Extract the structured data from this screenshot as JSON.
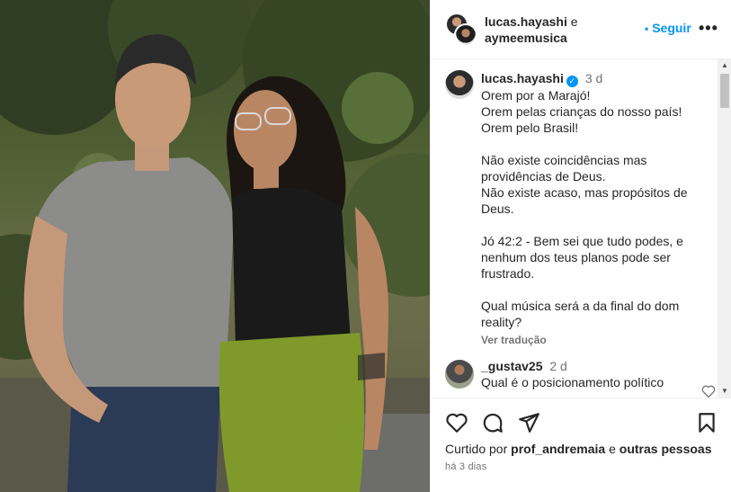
{
  "post": {
    "author_1": "lucas.hayashi",
    "connector": "e",
    "author_2": "aymeemusica",
    "follow_label": "Seguir",
    "more_label": "•••"
  },
  "caption": {
    "username": "lucas.hayashi",
    "verified_mark": "✓",
    "time": "3 d",
    "text": "Orem por a Marajó!\nOrem pelas crianças do nosso país!\nOrem pelo Brasil!\n\nNão existe coincidências mas providências de Deus.\nNão existe acaso, mas propósitos de Deus.\n\nJó 42:2 - Bem sei que tudo podes, e nenhum dos teus planos pode ser frustrado.\n\nQual música será a da final do dom reality?",
    "see_translation": "Ver tradução"
  },
  "comment": {
    "username": "_gustav25",
    "time": "2 d",
    "text": "Qual é o posicionamento político"
  },
  "footer": {
    "liked_prefix": "Curtido por",
    "liked_user": "prof_andremaia",
    "liked_connector": "e",
    "liked_others": "outras pessoas",
    "time_ago": "há 3 dias"
  },
  "icons": {
    "like": "heart-icon",
    "comment": "comment-icon",
    "share": "send-icon",
    "save": "bookmark-icon"
  },
  "colors": {
    "accent": "#0095f6",
    "muted": "#737373",
    "text": "#262626"
  }
}
